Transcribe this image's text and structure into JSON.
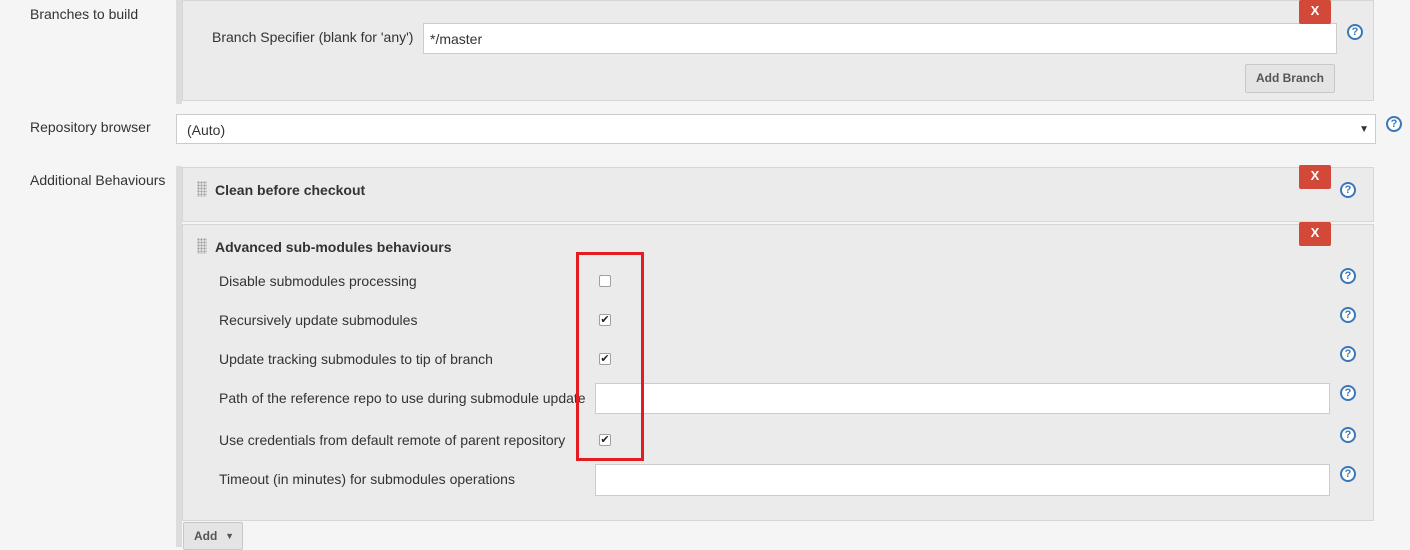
{
  "branches": {
    "label": "Branches to build",
    "specifier_label": "Branch Specifier (blank for 'any')",
    "specifier_value": "*/master",
    "add_branch_label": "Add Branch",
    "delete_label": "X"
  },
  "repo_browser": {
    "label": "Repository browser",
    "selected": "(Auto)"
  },
  "additional": {
    "label": "Additional Behaviours",
    "clean": {
      "title": "Clean before checkout",
      "delete_label": "X"
    },
    "submodules": {
      "title": "Advanced sub-modules behaviours",
      "delete_label": "X",
      "options": [
        {
          "label": "Disable submodules processing",
          "checked": false
        },
        {
          "label": "Recursively update submodules",
          "checked": true
        },
        {
          "label": "Update tracking submodules to tip of branch",
          "checked": true
        },
        {
          "label": "Path of the reference repo to use during submodule update",
          "value": ""
        },
        {
          "label": "Use credentials from default remote of parent repository",
          "checked": true
        },
        {
          "label": "Timeout (in minutes) for submodules operations",
          "value": ""
        }
      ]
    },
    "add_label": "Add"
  },
  "help_glyph": "?",
  "check_glyph": "✔",
  "colors": {
    "delete_button": "#d24939",
    "help_icon": "#3a77b9",
    "highlight": "#e31b23"
  }
}
